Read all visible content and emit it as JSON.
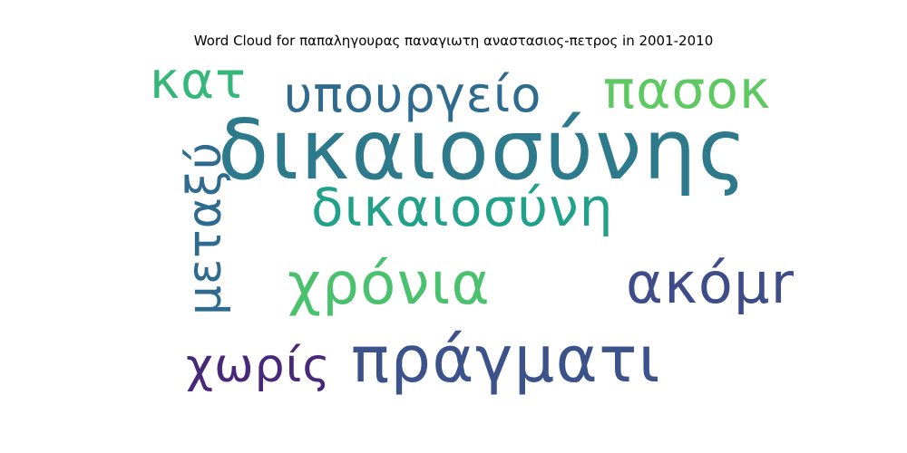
{
  "chart_data": {
    "type": "wordcloud",
    "title": "Word Cloud for παπαληγουρας παναγιωτη αναστασιος-πετρος in 2001-2010",
    "words": [
      {
        "text": "δικαιοσύνης",
        "weight": 1.0,
        "color": "#2c7a8c",
        "orientation": "horizontal"
      },
      {
        "text": "υπουργείο",
        "weight": 0.55,
        "color": "#2e6b8e",
        "orientation": "horizontal"
      },
      {
        "text": "πασοκ",
        "weight": 0.55,
        "color": "#5ec962",
        "orientation": "horizontal"
      },
      {
        "text": "κατ",
        "weight": 0.5,
        "color": "#35b779",
        "orientation": "horizontal"
      },
      {
        "text": "δικαιοσύνη",
        "weight": 0.55,
        "color": "#21a08a",
        "orientation": "horizontal"
      },
      {
        "text": "μεταξύ",
        "weight": 0.55,
        "color": "#2e6b8e",
        "orientation": "vertical"
      },
      {
        "text": "χρόνια",
        "weight": 0.62,
        "color": "#4ac16d",
        "orientation": "horizontal"
      },
      {
        "text": "ακόμη",
        "weight": 0.6,
        "color": "#3e4c8a",
        "orientation": "horizontal"
      },
      {
        "text": "χωρίς",
        "weight": 0.5,
        "color": "#482878",
        "orientation": "horizontal"
      },
      {
        "text": "πράγματι",
        "weight": 0.7,
        "color": "#3b528b",
        "orientation": "horizontal"
      }
    ]
  }
}
